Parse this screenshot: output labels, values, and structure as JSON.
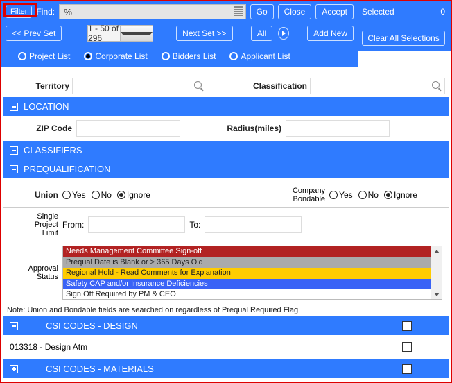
{
  "top": {
    "filter": "Filter",
    "find_label": "Find:",
    "find_value": "%",
    "go": "Go",
    "close": "Close",
    "accept": "Accept"
  },
  "nav": {
    "prev": "<< Prev Set",
    "pager": "1 - 50 of 296",
    "next": "Next Set >>",
    "all": "All",
    "addnew": "Add New"
  },
  "side": {
    "selected_label": "Selected",
    "selected_count": "0",
    "clear": "Clear All Selections"
  },
  "tabs": {
    "a": "Project List",
    "b": "Corporate List",
    "c": "Bidders List",
    "d": "Applicant List"
  },
  "fields": {
    "territory_label": "Territory",
    "classification_label": "Classification"
  },
  "sections": {
    "location": "LOCATION",
    "classifiers": "CLASSIFIERS",
    "prequal": "PREQUALIFICATION"
  },
  "location": {
    "zip_label": "ZIP Code",
    "radius_label": "Radius(miles)"
  },
  "prequal": {
    "union_label": "Union",
    "companybondable_label": "Company Bondable",
    "yes": "Yes",
    "no": "No",
    "ignore": "Ignore",
    "spl_label1": "Single",
    "spl_label2": "Project",
    "spl_label3": "Limit",
    "from": "From:",
    "to": "To:",
    "approval_label1": "Approval",
    "approval_label2": "Status",
    "options": {
      "o1": "Needs Management Committee Sign-off",
      "o2": "Prequal Date is Blank or > 365 Days Old",
      "o3": "Regional Hold - Read Comments for Explanation",
      "o4": "Safety CAP and/or Insurance Deficiencies",
      "o5": "Sign Off Required by PM & CEO"
    },
    "note": "Note: Union and Bondable fields are searched on regardless of Prequal Required Flag"
  },
  "csi": {
    "design": "CSI CODES - DESIGN",
    "materials": "CSI CODES - MATERIALS",
    "row1": "013318 - Design Atm"
  }
}
